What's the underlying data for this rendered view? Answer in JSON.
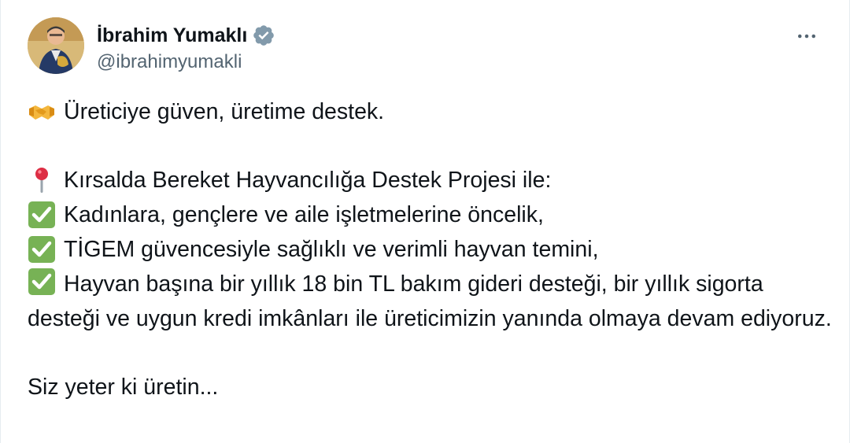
{
  "author": {
    "display_name": "İbrahim Yumaklı",
    "handle": "@ibrahimyumakli",
    "verified_icon": "verified-badge-icon",
    "avatar_icon": "avatar"
  },
  "menu": {
    "more_label": "More",
    "more_icon": "more-horizontal-icon"
  },
  "tweet": {
    "line1": {
      "emoji": "handshake-icon",
      "text": "Üreticiye güven, üretime destek."
    },
    "line2": {
      "emoji": "round-pushpin-icon",
      "text": "Kırsalda Bereket Hayvancılığa Destek Projesi ile:"
    },
    "line3": {
      "emoji": "check-mark-button-icon",
      "text": "Kadınlara, gençlere ve aile işletmelerine öncelik,"
    },
    "line4": {
      "emoji": "check-mark-button-icon",
      "text": "TİGEM güvencesiyle sağlıklı ve verimli hayvan temini,"
    },
    "line5": {
      "emoji": "check-mark-button-icon",
      "text": "Hayvan başına bir yıllık 18 bin TL bakım gideri desteği, bir yıllık sigorta desteği ve uygun kredi imkânları ile üreticimizin yanında olmaya devam ediyoruz."
    },
    "line6": {
      "text": "Siz yeter ki üretin..."
    }
  },
  "colors": {
    "text": "#0f1419",
    "secondary": "#536471",
    "verified": "#829aab",
    "check_green": "#77b255"
  }
}
